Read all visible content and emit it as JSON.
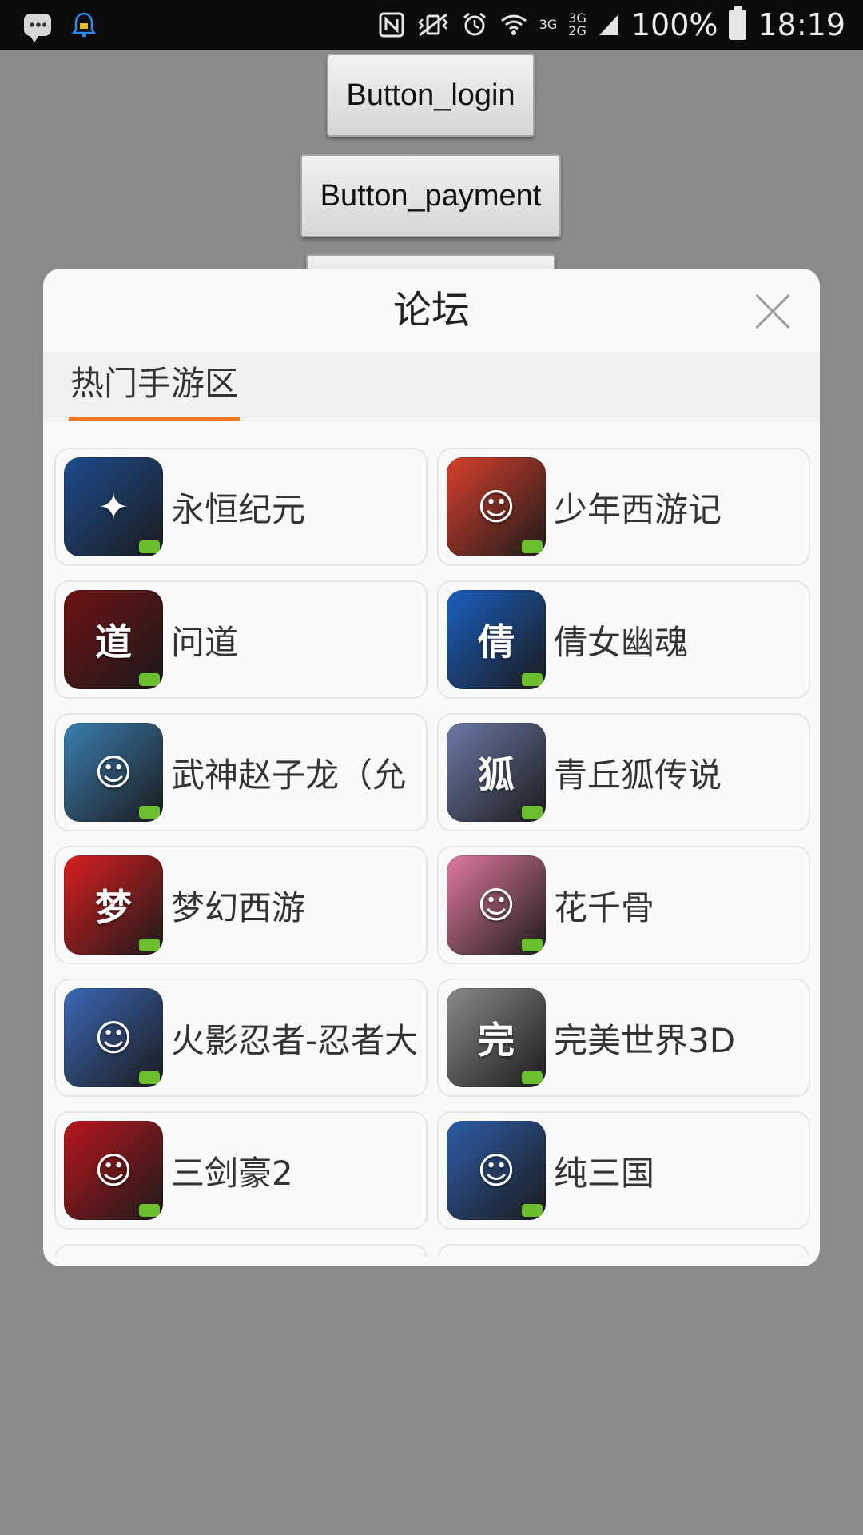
{
  "status_bar": {
    "battery_percent": "100%",
    "time": "18:19",
    "network_top": "3G",
    "network_mid_top": "3G",
    "network_mid_bottom": "2G",
    "icons": [
      "chat-icon",
      "bell-icon",
      "nfc-icon",
      "vibrate-icon",
      "alarm-icon",
      "wifi-icon",
      "signal-icon",
      "battery-icon"
    ]
  },
  "background_buttons": {
    "login": "Button_login",
    "payment": "Button_payment"
  },
  "dialog": {
    "title": "论坛",
    "tab": "热门手游区",
    "accent_color": "#f47a1f",
    "games": [
      {
        "name": "永恒纪元",
        "icon": "game-icon-winged-knight",
        "color": "#1d4c8f",
        "glyph": "✦"
      },
      {
        "name": "少年西游记",
        "icon": "game-icon-monkey-king",
        "color": "#d8402b",
        "glyph": "☺"
      },
      {
        "name": "问道",
        "icon": "game-icon-calligraphy",
        "color": "#6e1212",
        "glyph": "道"
      },
      {
        "name": "倩女幽魂",
        "icon": "game-icon-calligraphy-blue",
        "color": "#1a5fc0",
        "glyph": "倩"
      },
      {
        "name": "武神赵子龙（允",
        "icon": "game-icon-portrait-girl",
        "color": "#3a7fb1",
        "glyph": "☺"
      },
      {
        "name": "青丘狐传说",
        "icon": "game-icon-fox",
        "color": "#6d7aa8",
        "glyph": "狐"
      },
      {
        "name": "梦幻西游",
        "icon": "game-icon-dream",
        "color": "#d91f1f",
        "glyph": "梦"
      },
      {
        "name": "花千骨",
        "icon": "game-icon-portrait-pink",
        "color": "#e27aa1",
        "glyph": "☺"
      },
      {
        "name": "火影忍者-忍者大",
        "icon": "game-icon-ninja",
        "color": "#3b68b7",
        "glyph": "☺"
      },
      {
        "name": "完美世界3D",
        "icon": "game-icon-perfect-world",
        "color": "#8a8a8a",
        "glyph": "完"
      },
      {
        "name": "三剑豪2",
        "icon": "game-icon-swordswoman",
        "color": "#b8161e",
        "glyph": "☺"
      },
      {
        "name": "纯三国",
        "icon": "game-icon-warrior",
        "color": "#2d5da8",
        "glyph": "☺"
      }
    ]
  }
}
